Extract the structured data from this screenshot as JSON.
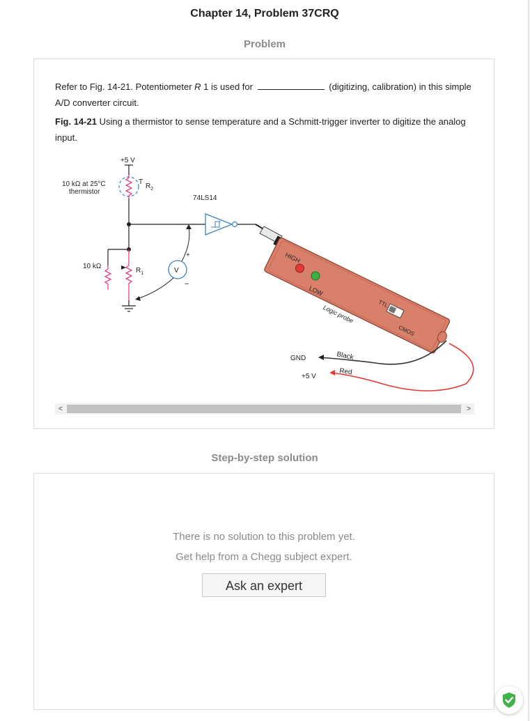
{
  "header": {
    "title": "Chapter 14, Problem 37CRQ"
  },
  "problem": {
    "section_title": "Problem",
    "text_before": "Refer to Fig. 14-21. Potentiometer ",
    "var_r": "R",
    "text_r1": " 1 is used for",
    "text_after": "(digitizing, calibration) in this simple A/D converter circuit.",
    "fig_label": "Fig. 14-21",
    "fig_caption": " Using a thermistor to sense temperature and a Schmitt-trigger inverter to digitize the analog input."
  },
  "figure": {
    "supply": "+5 V",
    "thermistor_line1": "10 kΩ at 25°C",
    "thermistor_line2": "thermistor",
    "t_label": "T",
    "r2_label": "R",
    "r2_sub": "2",
    "chip": "74LS14",
    "res10k": "10 kΩ",
    "r1_label": "R",
    "r1_sub": "1",
    "meter": "V",
    "meter_plus": "+",
    "meter_minus": "−",
    "high": "HIGH",
    "low": "LOW",
    "ttl": "TTL",
    "cmos": "CMOS",
    "probe_name": "Logic probe",
    "black": "Black",
    "red": "Red",
    "gnd": "GND",
    "plus5v": "+5 V"
  },
  "scroll": {
    "left": "<",
    "right": ">"
  },
  "solution": {
    "section_title": "Step-by-step solution",
    "line1": "There is no solution to this problem yet.",
    "line2": "Get help from a Chegg subject expert.",
    "button": "Ask an expert"
  },
  "colors": {
    "accent_blue": "#3b82c4",
    "probe_body": "#d9806a",
    "probe_border": "#8a3b2a",
    "led_red": "#e53935",
    "led_green": "#3cb043",
    "wire_red": "#e53935",
    "badge_green": "#41b24a"
  }
}
